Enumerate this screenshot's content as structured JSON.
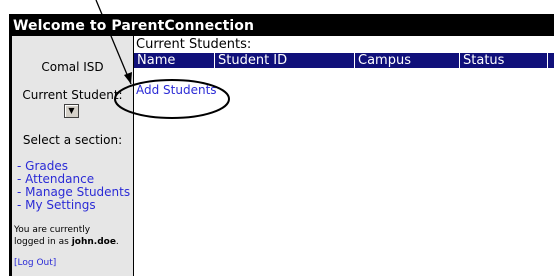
{
  "app": {
    "title": "Welcome to ParentConnection"
  },
  "sidebar": {
    "district": "Comal ISD",
    "current_student_label": "Current Student:",
    "select_section": "Select a section:",
    "nav": [
      {
        "label": "- Grades"
      },
      {
        "label": "- Attendance"
      },
      {
        "label": "- Manage Students"
      },
      {
        "label": "- My Settings"
      }
    ],
    "logged_line1": "You are currently",
    "logged_line2_prefix": "logged in as ",
    "username": "john.doe",
    "logged_suffix": ".",
    "logout": "[Log Out]"
  },
  "main": {
    "title": "Current Students:",
    "columns": [
      "Name",
      "Student ID",
      "Campus",
      "Status"
    ],
    "add_students": "Add Students"
  },
  "colors": {
    "header_bg": "#000000",
    "table_header_bg": "#10107a",
    "sidebar_bg": "#e6e6e6",
    "link": "#2b2bd6"
  }
}
